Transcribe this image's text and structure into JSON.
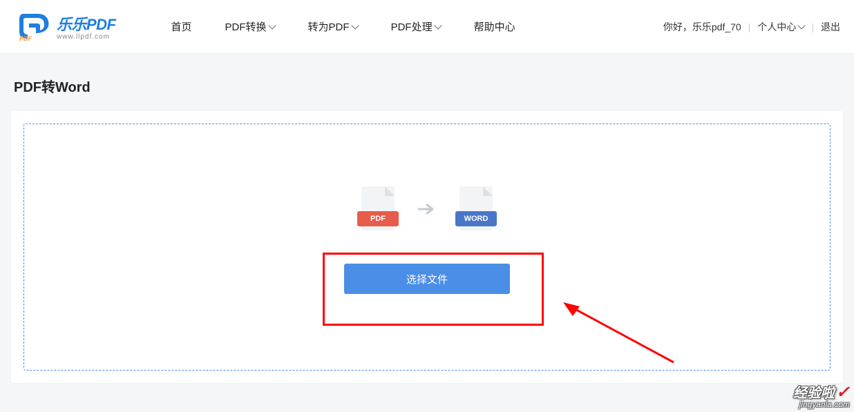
{
  "logo": {
    "main": "乐乐PDF",
    "sub": "www.llpdf.com"
  },
  "nav": {
    "home": "首页",
    "pdf_convert": "PDF转换",
    "to_pdf": "转为PDF",
    "pdf_process": "PDF处理",
    "help_center": "帮助中心"
  },
  "user": {
    "greeting": "你好，乐乐pdf_70",
    "personal_center": "个人中心",
    "logout": "退出"
  },
  "page": {
    "title": "PDF转Word"
  },
  "files": {
    "pdf": "PDF",
    "word": "WORD"
  },
  "upload": {
    "button_label": "选择文件"
  },
  "watermark": {
    "main": "经验啦",
    "sub": "jingyanla.com"
  }
}
